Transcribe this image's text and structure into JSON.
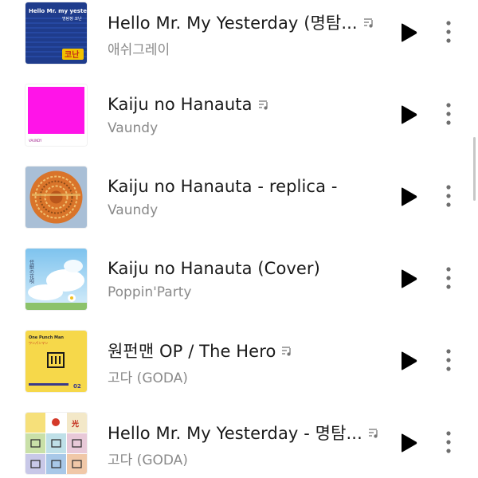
{
  "tracks": [
    {
      "title": "Hello Mr. My Yesterday (명탐...",
      "artist": "애쉬그레이",
      "has_lyrics": true,
      "art_text_top": "Hello Mr. my yesterday",
      "art_text_sub": "명탐정 코난",
      "art_logo": "코난"
    },
    {
      "title": "Kaiju no Hanauta",
      "artist": "Vaundy",
      "has_lyrics": true,
      "art_text_top": "VAUNDY"
    },
    {
      "title": "Kaiju no Hanauta - replica -",
      "artist": "Vaundy",
      "has_lyrics": false
    },
    {
      "title": "Kaiju no Hanauta (Cover)",
      "artist": "Poppin'Party",
      "has_lyrics": false,
      "art_text_top": "怪獣の花唄"
    },
    {
      "title": "원펀맨 OP / The Hero",
      "artist": "고다 (GODA)",
      "has_lyrics": true,
      "art_text_top": "One Punch Man",
      "art_text_sub": "ワンパンマン",
      "art_number": "02"
    },
    {
      "title": "Hello Mr. My Yesterday - 명탐...",
      "artist": "고다 (GODA)",
      "has_lyrics": true
    }
  ],
  "icons": {
    "play": "play-icon",
    "more": "more-vertical-icon",
    "lyrics": "lyrics-icon"
  },
  "colors": {
    "title": "#1a1a1a",
    "artist": "#8a8a8a",
    "play": "#000000",
    "more": "#6e6e6e"
  }
}
